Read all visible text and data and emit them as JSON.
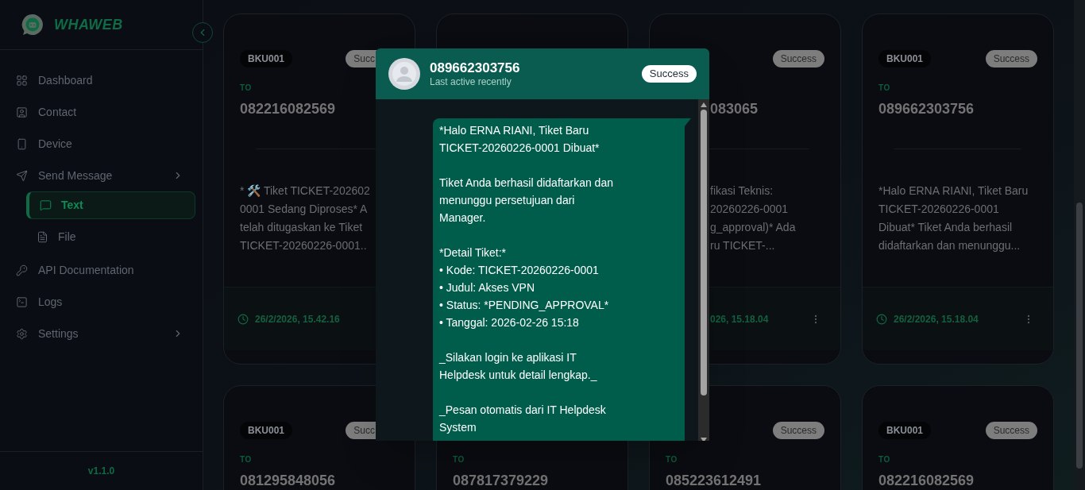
{
  "sidebar": {
    "logo_text": "WHAWEB",
    "items": [
      {
        "label": "Dashboard",
        "kind": "link",
        "selected": false
      },
      {
        "label": "Contact",
        "kind": "link",
        "selected": false
      },
      {
        "label": "Device",
        "kind": "link",
        "selected": false
      },
      {
        "label": "Send Message",
        "kind": "group",
        "selected": false,
        "children": [
          {
            "label": "Text",
            "selected": true
          },
          {
            "label": "File",
            "selected": false
          }
        ]
      },
      {
        "label": "API Documentation",
        "kind": "link",
        "selected": false
      },
      {
        "label": "Logs",
        "kind": "link",
        "selected": false
      },
      {
        "label": "Settings",
        "kind": "group",
        "selected": false
      }
    ],
    "version": "v1.1.0"
  },
  "cards": [
    {
      "kind": "right",
      "code": "BKU001",
      "status": "Succ",
      "to_label": "TO",
      "number": "082216082569",
      "message_lines": [
        "* 🛠️ Tiket TICKET-202602",
        "0001 Sedang Diproses* A",
        "telah ditugaskan ke Tiket",
        "TICKET-20260226-0001.."
      ],
      "time": "26/2/2026, 15.42.16"
    },
    {
      "kind": "hidden"
    },
    {
      "kind": "left",
      "status": "Success",
      "number": "083065",
      "message_lines": [
        "fikasi Teknis:",
        "20260226-0001",
        "g_approval)* Ada",
        "ru TICKET-..."
      ],
      "time": "026, 15.18.04"
    },
    {
      "kind": "full",
      "code": "BKU001",
      "status": "Success",
      "to_label": "TO",
      "number": "089662303756",
      "message_lines": [
        "*Halo ERNA RIANI, Tiket Baru",
        "TICKET-20260226-0001",
        "Dibuat* Tiket Anda berhasil",
        "didaftarkan dan menunggu..."
      ],
      "time": "26/2/2026, 15.18.04"
    },
    {
      "kind": "right",
      "code": "BKU001",
      "status": "Succ",
      "to_label": "TO",
      "number": "081295848056"
    },
    {
      "kind": "full",
      "to_label": "TO",
      "number": "087817379229"
    },
    {
      "kind": "full",
      "status": "Success",
      "to_label": "TO",
      "number": "085223612491"
    },
    {
      "kind": "full",
      "code": "BKU001",
      "status": "Success",
      "to_label": "TO",
      "number": "082216082569"
    }
  ],
  "preview": {
    "number": "089662303756",
    "subtitle": "Last active recently",
    "status": "Success",
    "paragraphs": [
      [
        "*Halo ERNA RIANI, Tiket Baru",
        "TICKET-20260226-0001 Dibuat*"
      ],
      [
        "Tiket Anda berhasil didaftarkan dan",
        "menunggu persetujuan dari",
        "Manager."
      ],
      [
        "*Detail Tiket:*",
        "• Kode: TICKET-20260226-0001",
        "• Judul: Akses VPN",
        "• Status: *PENDING_APPROVAL*",
        "• Tanggal: 2026-02-26 15:18"
      ],
      [
        "_Silakan login ke aplikasi IT",
        "Helpdesk untuk detail lengkap._"
      ],
      [
        "_Pesan otomatis dari IT Helpdesk",
        "System"
      ]
    ]
  }
}
